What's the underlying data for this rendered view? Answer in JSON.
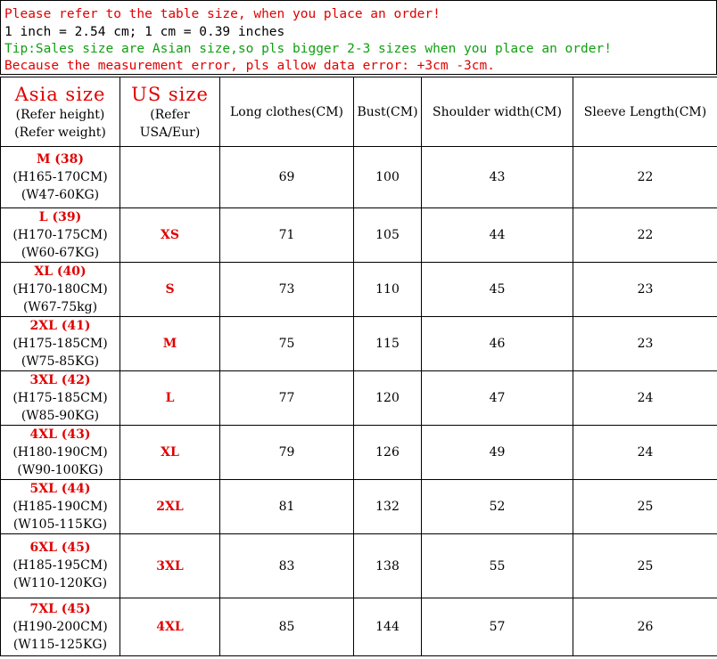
{
  "notes": {
    "line1": "Please refer to the table size, when you place an order!",
    "line2": "1 inch = 2.54 cm; 1 cm = 0.39 inches",
    "line3": "Tip:Sales size are Asian size,so pls bigger 2-3 sizes when you place an order!",
    "line4": "Because the measurement error, pls allow data error: +3cm -3cm."
  },
  "header": {
    "asia_title": "Asia size",
    "asia_sub1": "(Refer height)",
    "asia_sub2": "(Refer weight)",
    "us_title": "US size",
    "us_sub1": "(Refer",
    "us_sub2": "USA/Eur)",
    "col_long": "Long clothes(CM)",
    "col_bust": "Bust(CM)",
    "col_shoulder": "Shoulder width(CM)",
    "col_sleeve": "Sleeve Length(CM)"
  },
  "rows": [
    {
      "asia": "M (38)",
      "height": "(H165-170CM)",
      "weight": "(W47-60KG)",
      "us": "",
      "long": "69",
      "bust": "100",
      "shoulder": "43",
      "sleeve": "22"
    },
    {
      "asia": "L (39)",
      "height": "(H170-175CM)",
      "weight": "(W60-67KG)",
      "us": "XS",
      "long": "71",
      "bust": "105",
      "shoulder": "44",
      "sleeve": "22"
    },
    {
      "asia": "XL (40)",
      "height": "(H170-180CM)",
      "weight": "(W67-75kg)",
      "us": "S",
      "long": "73",
      "bust": "110",
      "shoulder": "45",
      "sleeve": "23"
    },
    {
      "asia": "2XL (41)",
      "height": "(H175-185CM)",
      "weight": "(W75-85KG)",
      "us": "M",
      "long": "75",
      "bust": "115",
      "shoulder": "46",
      "sleeve": "23"
    },
    {
      "asia": "3XL (42)",
      "height": "(H175-185CM)",
      "weight": "(W85-90KG)",
      "us": "L",
      "long": "77",
      "bust": "120",
      "shoulder": "47",
      "sleeve": "24"
    },
    {
      "asia": "4XL (43)",
      "height": "(H180-190CM)",
      "weight": "(W90-100KG)",
      "us": "XL",
      "long": "79",
      "bust": "126",
      "shoulder": "49",
      "sleeve": "24"
    },
    {
      "asia": "5XL (44)",
      "height": "(H185-190CM)",
      "weight": "(W105-115KG)",
      "us": "2XL",
      "long": "81",
      "bust": "132",
      "shoulder": "52",
      "sleeve": "25"
    },
    {
      "asia": "6XL (45)",
      "height": "(H185-195CM)",
      "weight": "(W110-120KG)",
      "us": "3XL",
      "long": "83",
      "bust": "138",
      "shoulder": "55",
      "sleeve": "25"
    },
    {
      "asia": "7XL (45)",
      "height": "(H190-200CM)",
      "weight": "(W115-125KG)",
      "us": "4XL",
      "long": "85",
      "bust": "144",
      "shoulder": "57",
      "sleeve": "26"
    }
  ],
  "colors": {
    "red": "#e00000",
    "green": "#10a010",
    "black": "#000000"
  }
}
